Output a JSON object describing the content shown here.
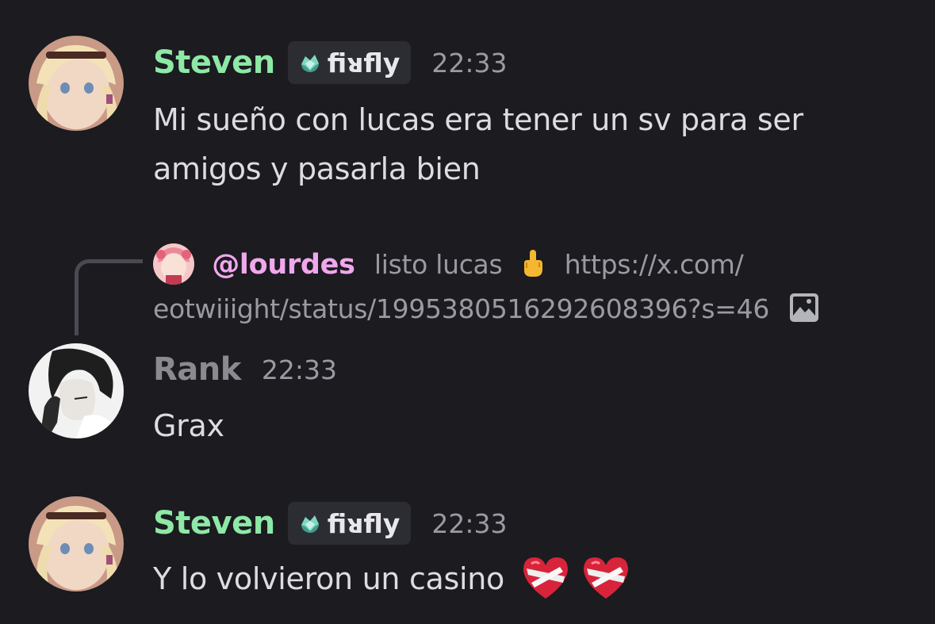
{
  "messages": [
    {
      "author": "Steven",
      "author_color": "#8ee8a6",
      "tag": "fiᴚfly",
      "tag_icon": "teal-gem-icon",
      "time": "22:33",
      "lines": [
        "Mi sueño con lucas era tener un sv para ser",
        "amigos y pasarla bien"
      ]
    },
    {
      "reply": {
        "mention": "@lourdes",
        "text": "listo lucas",
        "emoji": "middle-finger-emoji",
        "link_1": "https://x.com/",
        "link_2": "eotwiiight/status/1995380516292608396?s=46",
        "attachment_icon": "image-icon"
      },
      "author": "Rank",
      "author_color": "#8a8a90",
      "time": "22:33",
      "lines": [
        "Grax"
      ]
    },
    {
      "author": "Steven",
      "author_color": "#8ee8a6",
      "tag": "fiᴚfly",
      "tag_icon": "teal-gem-icon",
      "time": "22:33",
      "lines": [
        "Y lo volvieron un casino"
      ],
      "emojis": [
        "mending-heart-emoji",
        "mending-heart-emoji"
      ]
    }
  ]
}
